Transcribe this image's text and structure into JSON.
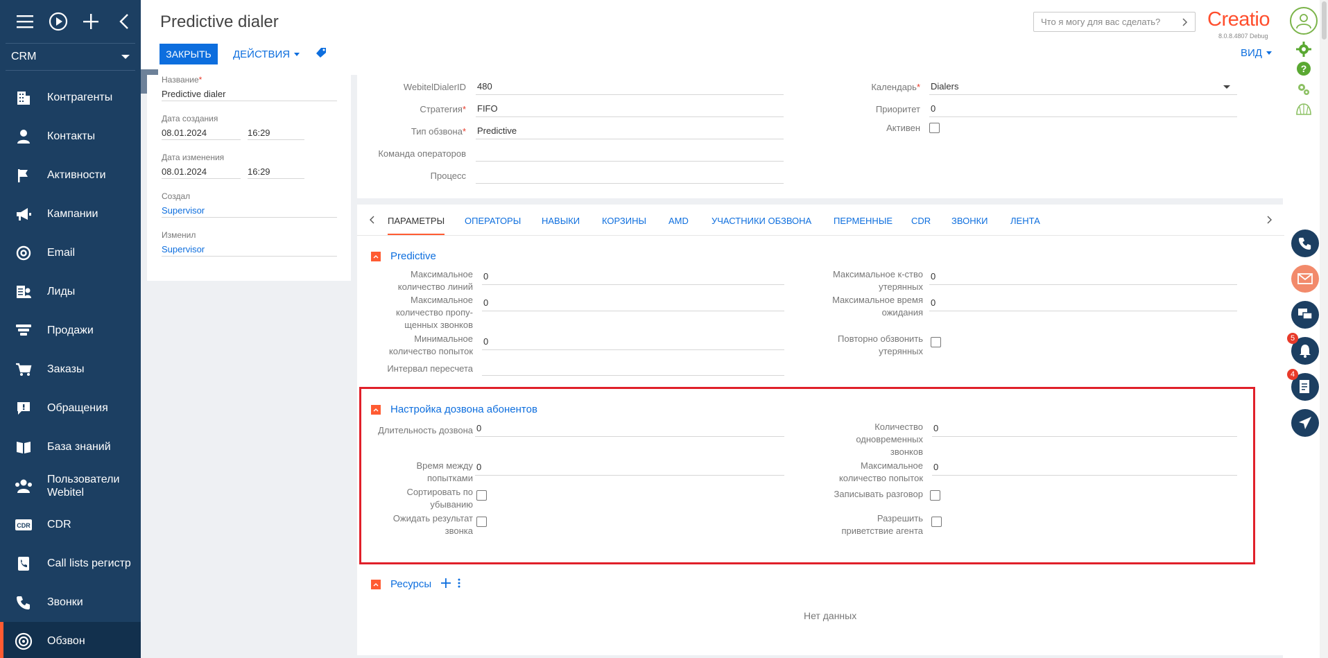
{
  "nav": {
    "crm_label": "CRM",
    "items": [
      {
        "label": "Контрагенты",
        "icon": "building-icon"
      },
      {
        "label": "Контакты",
        "icon": "person-icon"
      },
      {
        "label": "Активности",
        "icon": "flag-icon"
      },
      {
        "label": "Кампании",
        "icon": "megaphone-icon"
      },
      {
        "label": "Email",
        "icon": "at-icon"
      },
      {
        "label": "Лиды",
        "icon": "lead-icon"
      },
      {
        "label": "Продажи",
        "icon": "funnel-icon"
      },
      {
        "label": "Заказы",
        "icon": "cart-icon"
      },
      {
        "label": "Обращения",
        "icon": "chat-alert-icon"
      },
      {
        "label": "База знаний",
        "icon": "book-icon"
      },
      {
        "label": "Пользователи Webitel",
        "label_line1": "Пользователи",
        "label_line2": "Webitel",
        "icon": "users-icon"
      },
      {
        "label": "CDR",
        "icon": "cdr-icon"
      },
      {
        "label": "Call lists регистр",
        "icon": "phone-list-icon"
      },
      {
        "label": "Звонки",
        "icon": "phone-icon"
      },
      {
        "label": "Обзвон",
        "icon": "dialer-icon"
      }
    ]
  },
  "header": {
    "title": "Predictive dialer",
    "close_label": "ЗАКРЫТЬ",
    "actions_label": "ДЕЙСТВИЯ",
    "search_placeholder": "Что я могу для вас сделать?",
    "logo": "Creatio",
    "version": "8.0.8.4807 Debug",
    "view_label": "ВИД"
  },
  "info": {
    "name_label": "Название",
    "name_value": "Predictive dialer",
    "created_label": "Дата создания",
    "created_date": "08.01.2024",
    "created_time": "16:29",
    "modified_label": "Дата изменения",
    "modified_date": "08.01.2024",
    "modified_time": "16:29",
    "createdby_label": "Создал",
    "createdby_value": "Supervisor",
    "modifiedby_label": "Изменил",
    "modifiedby_value": "Supervisor"
  },
  "main": {
    "webitel_label": "WebitelDialerID",
    "webitel_value": "480",
    "strategy_label": "Стратегия",
    "strategy_value": "FIFO",
    "type_label": "Тип обзвона",
    "type_value": "Predictive",
    "team_label": "Команда операторов",
    "team_value": "",
    "process_label": "Процесс",
    "process_value": "",
    "calendar_label": "Календарь",
    "calendar_value": "Dialers",
    "priority_label": "Приоритет",
    "priority_value": "0",
    "active_label": "Активен"
  },
  "tabs": [
    "ПАРАМЕТРЫ",
    "ОПЕРАТОРЫ",
    "НАВЫКИ",
    "КОРЗИНЫ",
    "AMD",
    "УЧАСТНИКИ ОБЗВОНА",
    "ПЕРМЕННЫЕ",
    "CDR",
    "ЗВОНКИ",
    "ЛЕНТА"
  ],
  "predictive": {
    "title": "Predictive",
    "max_lines_l1": "Максимальное",
    "max_lines_l2": "количество линий",
    "max_lines_value": "0",
    "max_missed_l1": "Максимальное",
    "max_missed_l2": "количество пропу-",
    "max_missed_l3": "щенных звонков",
    "max_missed_value": "0",
    "min_attempts_l1": "Минимальное",
    "min_attempts_l2": "количество попыток",
    "min_attempts_value": "0",
    "recalc_label": "Интервал пересчета",
    "recalc_value": "",
    "max_lost_l1": "Максимальное к-ство",
    "max_lost_l2": "утерянных",
    "max_lost_value": "0",
    "max_wait_l1": "Максимальное время",
    "max_wait_l2": "ожидания",
    "max_wait_value": "0",
    "redial_l1": "Повторно обзвонить",
    "redial_l2": "утерянных"
  },
  "dial": {
    "title": "Настройка дозвона абонентов",
    "duration_label": "Длительность дозвона",
    "duration_value": "0",
    "between_l1": "Время между",
    "between_l2": "попытками",
    "between_value": "0",
    "sort_l1": "Сортировать по",
    "sort_l2": "убыванию",
    "wait_l1": "Ожидать результат",
    "wait_l2": "звонка",
    "concurrent_l1": "Количество",
    "concurrent_l2": "одновременных",
    "concurrent_l3": "звонков",
    "concurrent_value": "0",
    "max_attempts_l1": "Максимальное",
    "max_attempts_l2": "количество попыток",
    "max_attempts_value": "0",
    "record_label": "Записывать разговор",
    "greet_l1": "Разрешить",
    "greet_l2": "приветствие агента"
  },
  "resources": {
    "title": "Ресурсы",
    "empty": "Нет данных"
  },
  "rail": {
    "notif_count": "5",
    "tasks_count": "4"
  }
}
